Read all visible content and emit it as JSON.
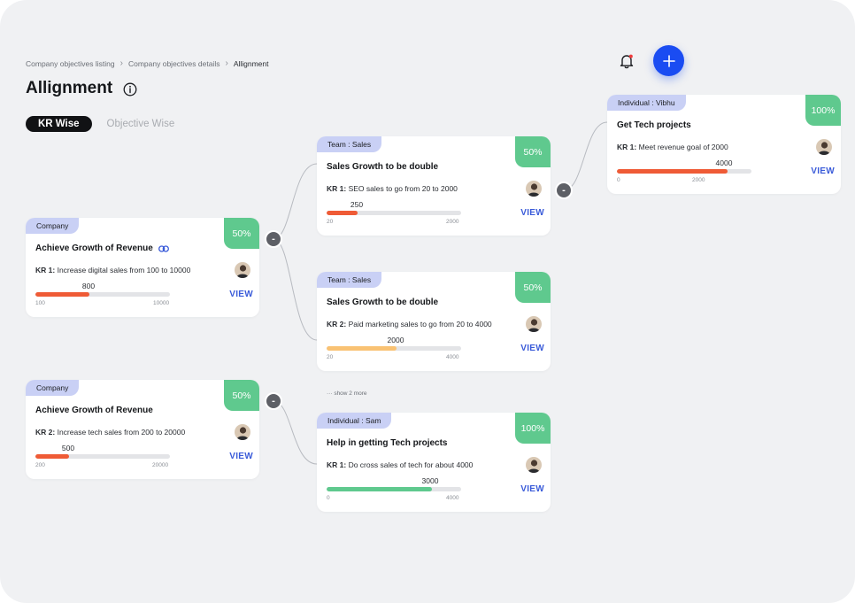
{
  "breadcrumb": {
    "items": [
      "Company objectives listing",
      "Company objectives details",
      "Allignment"
    ]
  },
  "page": {
    "title": "Allignment"
  },
  "view_toggle": {
    "active": "KR Wise",
    "inactive": "Objective Wise"
  },
  "header_actions": {
    "bell_icon": "bell-icon",
    "add_icon": "plus-icon"
  },
  "cards": [
    {
      "tag": "Company",
      "percent": "50%",
      "title": "Achieve Growth of Revenue",
      "has_link": true,
      "kr_label": "KR 1:",
      "kr_text": "Increase digital sales from 100 to 10000",
      "value": "800",
      "min": "100",
      "max": "10000",
      "progress": 0.4,
      "bar_color": "#ef5b36",
      "view": "VIEW"
    },
    {
      "tag": "Company",
      "percent": "50%",
      "title": "Achieve Growth of Revenue",
      "has_link": false,
      "kr_label": "KR 2:",
      "kr_text": "Increase tech sales from 200 to 20000",
      "value": "500",
      "min": "200",
      "max": "20000",
      "progress": 0.25,
      "bar_color": "#ef5b36",
      "view": "VIEW"
    },
    {
      "tag": "Team : Sales",
      "percent": "50%",
      "title": "Sales Growth to be double",
      "has_link": false,
      "kr_label": "KR 1:",
      "kr_text": "SEO sales to go from 20 to 2000",
      "value": "250",
      "min": "20",
      "max": "2000",
      "progress": 0.23,
      "bar_color": "#ef5b36",
      "view": "VIEW"
    },
    {
      "tag": "Team : Sales",
      "percent": "50%",
      "title": "Sales Growth to be double",
      "has_link": false,
      "kr_label": "KR 2:",
      "kr_text": "Paid marketing  sales to go from 20 to 4000",
      "value": "2000",
      "min": "20",
      "max": "4000",
      "progress": 0.52,
      "bar_color": "#f9c273",
      "view": "VIEW"
    },
    {
      "tag": "Individual : Sam",
      "percent": "100%",
      "title": "Help in getting Tech projects",
      "has_link": false,
      "kr_label": "KR 1:",
      "kr_text": "Do cross sales of tech for about 4000",
      "value": "3000",
      "min": "0",
      "max": "4000",
      "progress": 0.78,
      "bar_color": "#5fc98e",
      "view": "VIEW"
    },
    {
      "tag": "Individual : Vibhu",
      "percent": "100%",
      "title": "Get Tech projects",
      "has_link": false,
      "kr_label": "KR 1:",
      "kr_text": "Meet revenue goal of 2000",
      "value": "4000",
      "min": "0",
      "max": "2000",
      "progress": 0.82,
      "bar_color": "#ef5b36",
      "view": "VIEW"
    }
  ],
  "collapse_symbol": "-",
  "show_more": "show 2 more",
  "colors": {
    "accent": "#1a4cf2",
    "tag_bg": "#c9d0f5",
    "percent_bg": "#5fc98e",
    "view_text": "#3a5bd9"
  }
}
